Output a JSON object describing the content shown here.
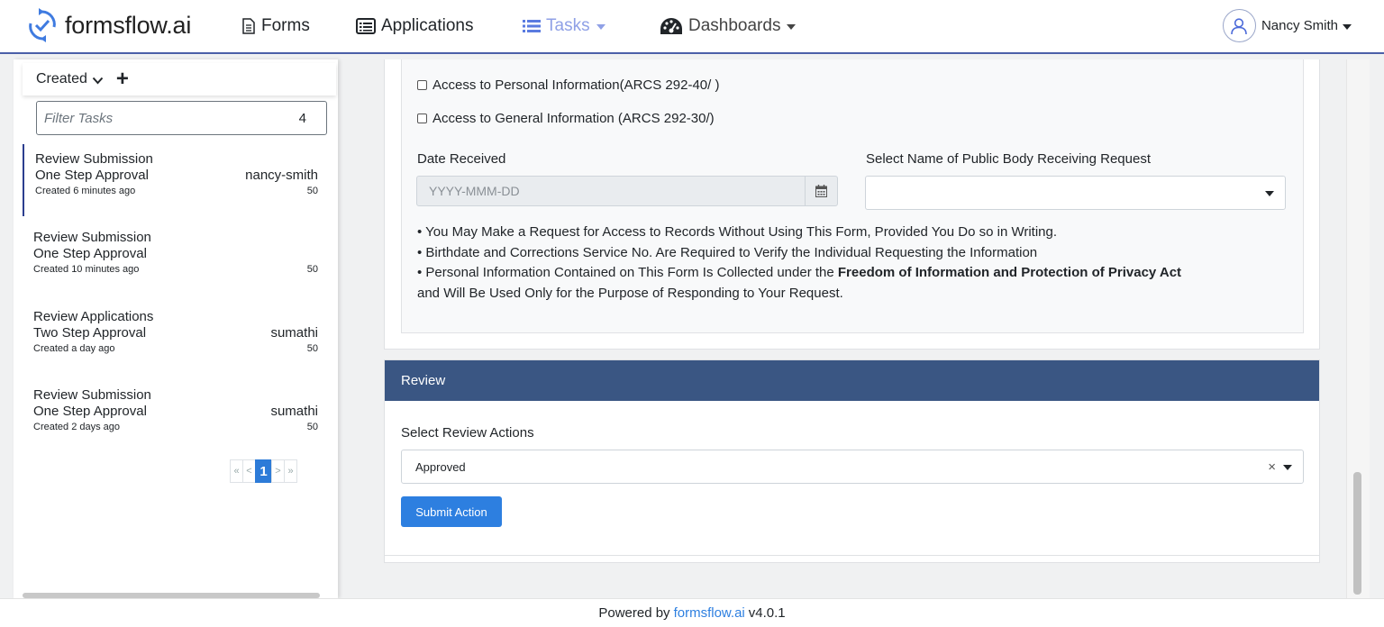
{
  "navbar": {
    "brand": "formsflow.ai",
    "items": [
      {
        "label": "Forms",
        "icon": "document-icon"
      },
      {
        "label": "Applications",
        "icon": "list-box-icon"
      },
      {
        "label": "Tasks",
        "icon": "list-icon"
      },
      {
        "label": "Dashboards",
        "icon": "dashboard-icon"
      }
    ],
    "active_color": "#8fa0e6",
    "user": "Nancy Smith"
  },
  "sidebar": {
    "sort_label": "Created",
    "filter_placeholder": "Filter Tasks",
    "task_count": "4",
    "tasks": [
      {
        "name": "Review Submission",
        "process": "One Step Approval",
        "assignee": "nancy-smith",
        "created": "Created 6 minutes ago",
        "priority": "50"
      },
      {
        "name": "Review Submission",
        "process": "One Step Approval",
        "assignee": "",
        "created": "Created 10 minutes ago",
        "priority": "50"
      },
      {
        "name": "Review Applications",
        "process": "Two Step Approval",
        "assignee": "sumathi",
        "created": "Created a day ago",
        "priority": "50"
      },
      {
        "name": "Review Submission",
        "process": "One Step Approval",
        "assignee": "sumathi",
        "created": "Created 2 days ago",
        "priority": "50"
      }
    ],
    "pagination": {
      "first": "«",
      "prev": "<",
      "current": "1",
      "next": ">",
      "last": "»"
    }
  },
  "form": {
    "checkbox_personal": "Access to Personal Information(ARCS 292-40/ )",
    "checkbox_general": "Access to General Information (ARCS 292-30/)",
    "date_label": "Date Received",
    "date_placeholder": "YYYY-MMM-DD",
    "public_body_label": "Select Name of Public Body Receiving Request",
    "notes": {
      "line1": "• You May Make a Request for Access to Records Without Using This Form, Provided You Do so in Writing.",
      "line2": "• Birthdate and Corrections Service No. Are Required to Verify the Individual Requesting the Information",
      "line3_prefix": "• Personal Information Contained on This Form Is Collected under the ",
      "line3_bold": "Freedom of Information and Protection of Privacy Act",
      "line4": "and Will Be Used Only for the Purpose of Responding to Your Request."
    }
  },
  "review": {
    "header": "Review",
    "header_color": "#3a5683",
    "actions_label": "Select Review Actions",
    "selected_action": "Approved",
    "clear_symbol": "×",
    "submit_label": "Submit Action",
    "submit_color": "#2d7fe0"
  },
  "footer": {
    "prefix": "Powered by",
    "link": "formsflow.ai",
    "version": "v4.0.1"
  }
}
